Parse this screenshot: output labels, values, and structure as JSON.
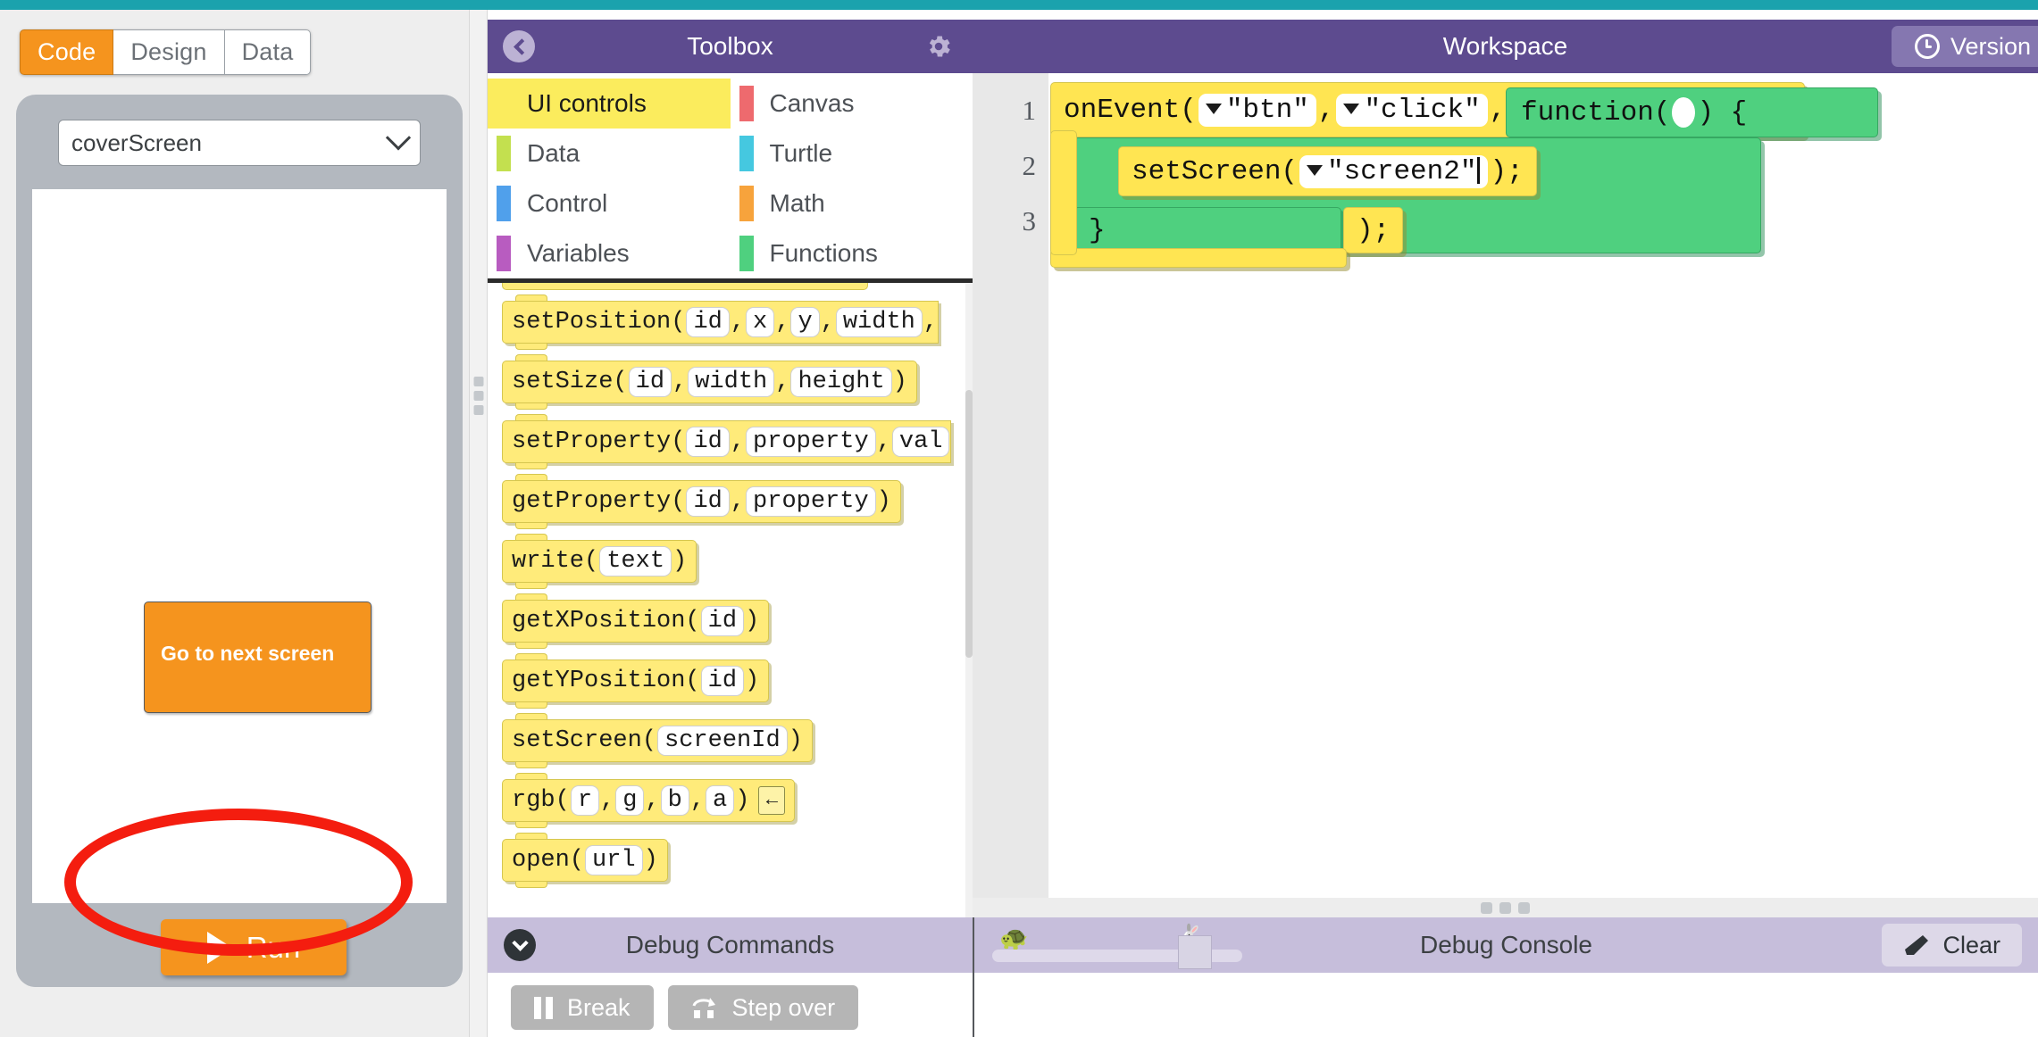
{
  "top_bar": {
    "color": "#1ba2ad"
  },
  "mode_tabs": [
    {
      "label": "Code",
      "active": true
    },
    {
      "label": "Design",
      "active": false
    },
    {
      "label": "Data",
      "active": false
    }
  ],
  "app_preview": {
    "screen_select_value": "coverScreen",
    "button_label": "Go to next screen",
    "button_color": "#f5941e",
    "run_label": "Run",
    "annotation": "red-ellipse-highlight-around-run-button"
  },
  "toolbox": {
    "title": "Toolbox",
    "back_icon": "chevron-left-icon",
    "gear_icon": "gear-icon",
    "categories": [
      {
        "label": "UI controls",
        "color": "#fbec5d",
        "selected": true
      },
      {
        "label": "Canvas",
        "color": "#ee6a6e",
        "selected": false
      },
      {
        "label": "Data",
        "color": "#c3e04f",
        "selected": false
      },
      {
        "label": "Turtle",
        "color": "#45c8e0",
        "selected": false
      },
      {
        "label": "Control",
        "color": "#50a0eb",
        "selected": false
      },
      {
        "label": "Math",
        "color": "#f7a33c",
        "selected": false
      },
      {
        "label": "Variables",
        "color": "#b85cc0",
        "selected": false
      },
      {
        "label": "Functions",
        "color": "#4fd07f",
        "selected": false
      }
    ],
    "blocks": [
      {
        "name": "setPosition",
        "parts": [
          {
            "t": "text",
            "v": "setPosition("
          },
          {
            "t": "field",
            "v": "id"
          },
          {
            "t": "text",
            "v": ", "
          },
          {
            "t": "field",
            "v": "x"
          },
          {
            "t": "text",
            "v": ", "
          },
          {
            "t": "field",
            "v": "y"
          },
          {
            "t": "text",
            "v": ", "
          },
          {
            "t": "field",
            "v": "width"
          },
          {
            "t": "text",
            "v": ","
          }
        ],
        "clipped": true
      },
      {
        "name": "setSize",
        "parts": [
          {
            "t": "text",
            "v": "setSize("
          },
          {
            "t": "field",
            "v": "id"
          },
          {
            "t": "text",
            "v": ", "
          },
          {
            "t": "field",
            "v": "width"
          },
          {
            "t": "text",
            "v": ", "
          },
          {
            "t": "field",
            "v": "height"
          },
          {
            "t": "text",
            "v": ")"
          }
        ],
        "clipped": false
      },
      {
        "name": "setProperty",
        "parts": [
          {
            "t": "text",
            "v": "setProperty("
          },
          {
            "t": "field",
            "v": "id"
          },
          {
            "t": "text",
            "v": ", "
          },
          {
            "t": "field",
            "v": "property"
          },
          {
            "t": "text",
            "v": ", "
          },
          {
            "t": "field",
            "v": "val"
          }
        ],
        "clipped": true
      },
      {
        "name": "getProperty",
        "parts": [
          {
            "t": "text",
            "v": "getProperty("
          },
          {
            "t": "field",
            "v": "id"
          },
          {
            "t": "text",
            "v": ", "
          },
          {
            "t": "field",
            "v": "property"
          },
          {
            "t": "text",
            "v": ")"
          }
        ],
        "clipped": false
      },
      {
        "name": "write",
        "parts": [
          {
            "t": "text",
            "v": "write("
          },
          {
            "t": "field",
            "v": "text"
          },
          {
            "t": "text",
            "v": ")"
          }
        ],
        "clipped": false
      },
      {
        "name": "getXPosition",
        "parts": [
          {
            "t": "text",
            "v": "getXPosition("
          },
          {
            "t": "field",
            "v": "id"
          },
          {
            "t": "text",
            "v": ")"
          }
        ],
        "clipped": false
      },
      {
        "name": "getYPosition",
        "parts": [
          {
            "t": "text",
            "v": "getYPosition("
          },
          {
            "t": "field",
            "v": "id"
          },
          {
            "t": "text",
            "v": ")"
          }
        ],
        "clipped": false
      },
      {
        "name": "setScreen",
        "parts": [
          {
            "t": "text",
            "v": "setScreen("
          },
          {
            "t": "field",
            "v": "screenId"
          },
          {
            "t": "text",
            "v": ")"
          }
        ],
        "clipped": false
      },
      {
        "name": "rgb",
        "parts": [
          {
            "t": "text",
            "v": "rgb("
          },
          {
            "t": "field",
            "v": "r"
          },
          {
            "t": "text",
            "v": ", "
          },
          {
            "t": "field",
            "v": "g"
          },
          {
            "t": "text",
            "v": ", "
          },
          {
            "t": "field",
            "v": "b"
          },
          {
            "t": "text",
            "v": ", "
          },
          {
            "t": "field",
            "v": "a"
          },
          {
            "t": "text",
            "v": ")"
          },
          {
            "t": "minibtn",
            "v": "←"
          }
        ],
        "clipped": false
      },
      {
        "name": "open",
        "parts": [
          {
            "t": "text",
            "v": "open("
          },
          {
            "t": "field",
            "v": "url"
          },
          {
            "t": "text",
            "v": ")"
          }
        ],
        "clipped": false
      }
    ]
  },
  "workspace": {
    "title": "Workspace",
    "version_label": "Version",
    "version_icon": "clock-icon",
    "line_numbers": [
      "1",
      "2",
      "3"
    ],
    "code": {
      "line1": {
        "prefix": "onEvent(",
        "arg1": "\"btn\"",
        "sep1": ", ",
        "arg2": "\"click\"",
        "sep2": ",",
        "fn_open": "function(",
        "fn_close": ") {"
      },
      "line2": {
        "prefix": "setScreen(",
        "arg": "\"screen2\"",
        "suffix": ");"
      },
      "line3": {
        "brace": "}",
        "tail": ");"
      }
    }
  },
  "debug_commands": {
    "title": "Debug Commands",
    "collapse_icon": "chevron-down-icon",
    "buttons": [
      {
        "label": "Break",
        "icon": "pause-icon"
      },
      {
        "label": "Step over",
        "icon": "step-over-icon"
      }
    ]
  },
  "debug_console": {
    "title": "Debug Console",
    "clear_label": "Clear",
    "clear_icon": "eraser-icon",
    "speed_slider": {
      "slow_icon": "turtle-icon",
      "fast_icon": "rabbit-icon",
      "value": 74
    }
  }
}
